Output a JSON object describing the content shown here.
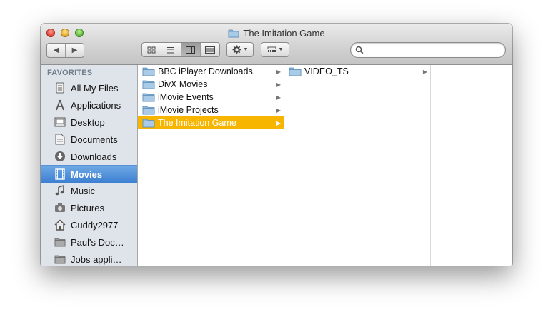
{
  "window": {
    "title": "The Imitation Game"
  },
  "toolbar": {
    "back_glyph": "◀",
    "forward_glyph": "▶",
    "search_placeholder": ""
  },
  "sidebar": {
    "header": "FAVORITES",
    "items": [
      {
        "label": "All My Files",
        "icon": "all-files-icon"
      },
      {
        "label": "Applications",
        "icon": "applications-icon"
      },
      {
        "label": "Desktop",
        "icon": "desktop-icon"
      },
      {
        "label": "Documents",
        "icon": "documents-icon"
      },
      {
        "label": "Downloads",
        "icon": "downloads-icon"
      },
      {
        "label": "Movies",
        "icon": "movies-icon",
        "selected": true
      },
      {
        "label": "Music",
        "icon": "music-icon"
      },
      {
        "label": "Pictures",
        "icon": "pictures-icon"
      },
      {
        "label": "Cuddy2977",
        "icon": "home-icon"
      },
      {
        "label": "Paul's Doc…",
        "icon": "folder-icon"
      },
      {
        "label": "Jobs appli…",
        "icon": "folder-icon"
      }
    ]
  },
  "columns": {
    "col1": [
      {
        "label": "BBC iPlayer Downloads"
      },
      {
        "label": "DivX Movies"
      },
      {
        "label": "iMovie Events"
      },
      {
        "label": "iMovie Projects"
      },
      {
        "label": "The Imitation Game",
        "selected": true
      }
    ],
    "col2": [
      {
        "label": "VIDEO_TS"
      }
    ]
  },
  "colors": {
    "selection_sidebar": "#3d7fd2",
    "selection_column": "#f8b500",
    "sidebar_bg": "#dfe4ea"
  }
}
